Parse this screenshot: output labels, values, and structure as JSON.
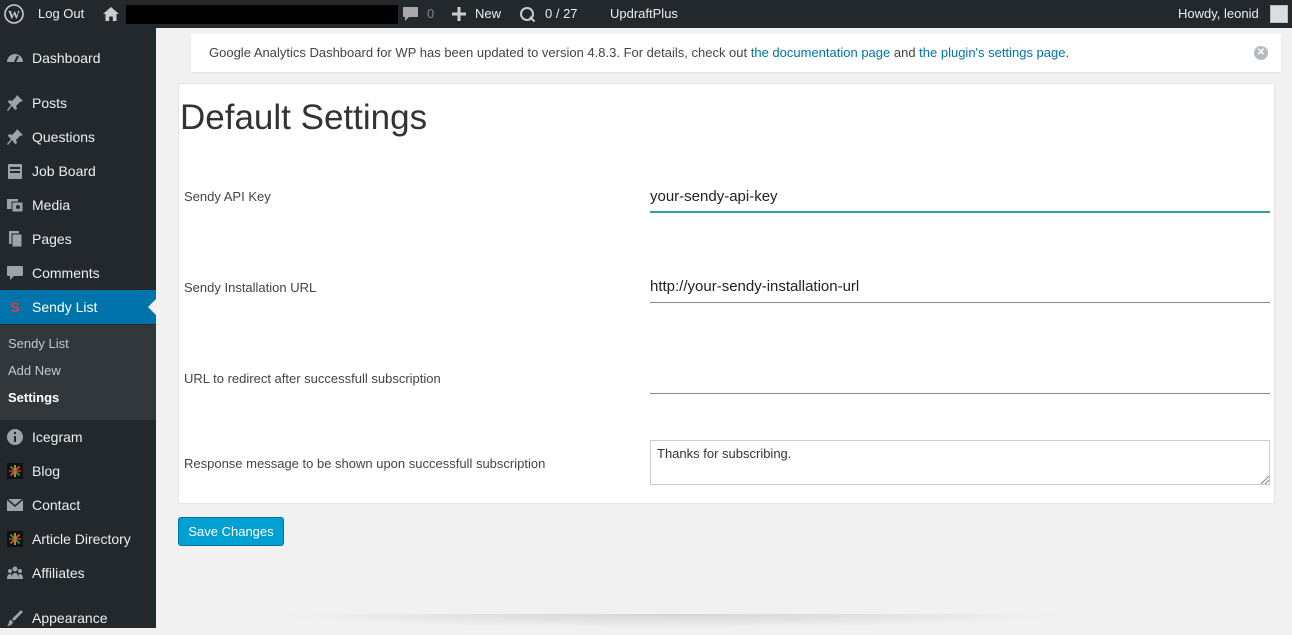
{
  "admin_bar": {
    "logout": "Log Out",
    "comments_count": "0",
    "new_label": "New",
    "counter": "0 / 27",
    "updraft": "UpdraftPlus",
    "howdy": "Howdy, leonid"
  },
  "sidebar": {
    "items": [
      {
        "label": "Dashboard",
        "icon": "dashboard-icon"
      },
      {
        "label": "Posts",
        "icon": "pin-icon"
      },
      {
        "label": "Questions",
        "icon": "pin-icon"
      },
      {
        "label": "Job Board",
        "icon": "briefcase-icon"
      },
      {
        "label": "Media",
        "icon": "media-icon"
      },
      {
        "label": "Pages",
        "icon": "pages-icon"
      },
      {
        "label": "Comments",
        "icon": "comment-icon"
      },
      {
        "label": "Sendy List",
        "icon": "sendy-icon"
      },
      {
        "label": "Icegram",
        "icon": "info-icon"
      },
      {
        "label": "Blog",
        "icon": "star-icon"
      },
      {
        "label": "Contact",
        "icon": "mail-icon"
      },
      {
        "label": "Article Directory",
        "icon": "star-icon"
      },
      {
        "label": "Affiliates",
        "icon": "group-icon"
      },
      {
        "label": "Appearance",
        "icon": "brush-icon"
      }
    ],
    "submenu": [
      "Sendy List",
      "Add New",
      "Settings"
    ]
  },
  "notice": {
    "text_before": "Google Analytics Dashboard for WP has been updated to version 4.8.3. For details, check out ",
    "link1": "the documentation page",
    "text_middle": " and ",
    "link2": "the plugin's settings page",
    "text_after": "."
  },
  "settings": {
    "title": "Default Settings",
    "fields": [
      {
        "label": "Sendy API Key",
        "value": "your-sendy-api-key"
      },
      {
        "label": "Sendy Installation URL",
        "value": "http://your-sendy-installation-url"
      },
      {
        "label": "URL to redirect after successfull subscription",
        "value": ""
      },
      {
        "label": "Response message to be shown upon successfull subscription",
        "value": "Thanks for subscribing."
      }
    ],
    "save_label": "Save Changes"
  },
  "colors": {
    "admin_bg": "#23282d",
    "active_menu": "#0073aa",
    "link": "#0073aa",
    "button": "#00a0d2",
    "focus_underline": "#26a69a"
  }
}
